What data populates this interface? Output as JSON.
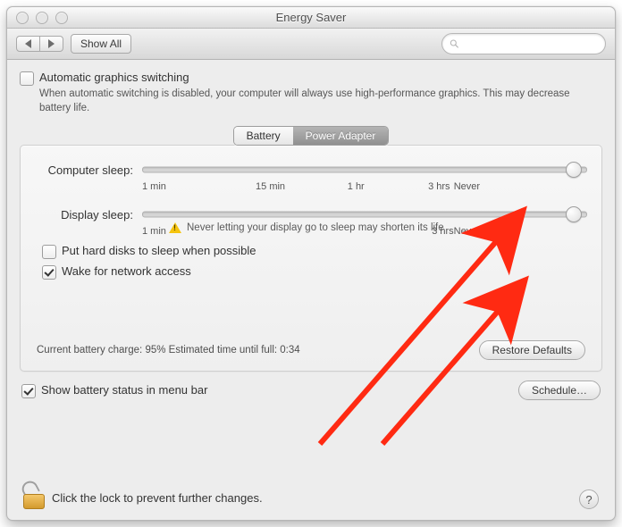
{
  "window": {
    "title": "Energy Saver"
  },
  "toolbar": {
    "show_all": "Show All",
    "search_placeholder": ""
  },
  "auto_graphics": {
    "checked": false,
    "label": "Automatic graphics switching",
    "hint": "When automatic switching is disabled, your computer will always use high-performance graphics. This may decrease battery life."
  },
  "tabs": {
    "battery": "Battery",
    "power_adapter": "Power Adapter",
    "selected": "power_adapter"
  },
  "sliders": {
    "computer": {
      "label": "Computer sleep:",
      "value_pct": 97
    },
    "display": {
      "label": "Display sleep:",
      "value_pct": 97
    },
    "ticks": {
      "t1": "1 min",
      "t2": "15 min",
      "t3": "1 hr",
      "t4": "3 hrs",
      "t5": "Never"
    },
    "display_warning": "Never letting your display go to sleep may shorten its life"
  },
  "options": {
    "hard_disk": {
      "checked": false,
      "label": "Put hard disks to sleep when possible"
    },
    "wake_net": {
      "checked": true,
      "label": "Wake for network access"
    }
  },
  "status": {
    "text": "Current battery charge: 95%  Estimated time until full: 0:34",
    "restore": "Restore Defaults"
  },
  "show_battery_menu": {
    "checked": true,
    "label": "Show battery status in menu bar"
  },
  "schedule_btn": "Schedule…",
  "lock_text": "Click the lock to prevent further changes.",
  "help": "?"
}
